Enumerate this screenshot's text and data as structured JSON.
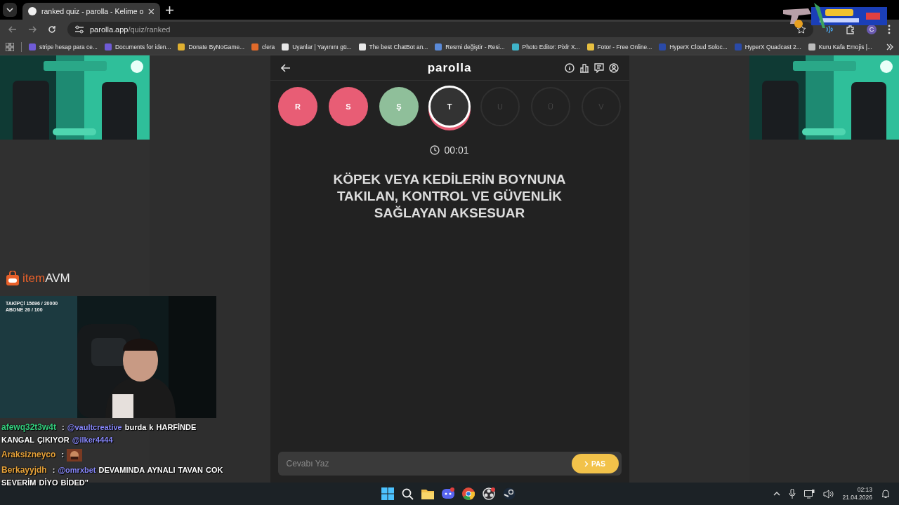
{
  "browser": {
    "tab_title": "ranked quiz - parolla - Kelime o",
    "url_host": "parolla.app",
    "url_path": "/quiz/ranked",
    "profile_initial": "C",
    "bookmarks": [
      {
        "label": "stripe hesap para ce...",
        "color": "#6f5bd6"
      },
      {
        "label": "Documents for iden...",
        "color": "#6f5bd6"
      },
      {
        "label": "Donate ByNoGame...",
        "color": "#e0b030"
      },
      {
        "label": "clera",
        "color": "#e06a2a"
      },
      {
        "label": "Uyanlar | Yayınını gü...",
        "color": "#e8e8e8"
      },
      {
        "label": "The best ChatBot an...",
        "color": "#e8e8e8"
      },
      {
        "label": "Resmi değiştir - Resi...",
        "color": "#5a8ad8"
      },
      {
        "label": "Photo Editor: Pixlr X...",
        "color": "#3fb3c8"
      },
      {
        "label": "Fotor - Free Online...",
        "color": "#e8c040"
      },
      {
        "label": "HyperX Cloud Soloc...",
        "color": "#2a4aa8"
      },
      {
        "label": "HyperX Quadcast 2...",
        "color": "#2a4aa8"
      },
      {
        "label": "Kuru Kafa Emojis |...",
        "color": "#bbbbbb"
      }
    ]
  },
  "app": {
    "title": "parolla",
    "letters": [
      {
        "letter": "R",
        "kind": "wrong"
      },
      {
        "letter": "S",
        "kind": "wrong"
      },
      {
        "letter": "Ş",
        "kind": "correct"
      },
      {
        "letter": "T",
        "kind": "current"
      },
      {
        "letter": "U",
        "kind": "pending"
      },
      {
        "letter": "Ü",
        "kind": "pending"
      },
      {
        "letter": "V",
        "kind": "pending"
      }
    ],
    "timer": "00:01",
    "question": "KÖPEK VEYA KEDİLERİN BOYNUNA TAKILAN, KONTROL VE GÜVENLİK SAĞLAYAN AKSESUAR",
    "answer": {
      "placeholder": "Cevabı Yaz"
    },
    "pass_button": "PAS"
  },
  "stream_overlay": {
    "logo": {
      "first": "item",
      "second": "AVM"
    },
    "stats": [
      "TAKİPÇİ 15696 / 20000",
      "ABONE 26 / 100"
    ],
    "chat": [
      {
        "user": "afewq32t3w4t",
        "separator": ":",
        "color": "#35d07f",
        "kind": "text",
        "parts": [
          {
            "text": "@vaultcreative",
            "mention": true
          },
          {
            "text": "burda k HARFİNDE",
            "mention": false
          },
          {
            "text": "KANGAL ÇIKIYOR",
            "mention": false
          },
          {
            "text": "@ilker4444",
            "mention": true
          }
        ]
      },
      {
        "user": "Araksizneyco",
        "separator": ":",
        "color": "#e8a33a",
        "kind": "emote"
      },
      {
        "user": "Berkayyjdh",
        "separator": ":",
        "color": "#e8a33a",
        "kind": "text",
        "parts": [
          {
            "text": "@omrxbet",
            "mention": true
          },
          {
            "text": "DEVAMINDA AYNALI TAVAN COK",
            "mention": false
          },
          {
            "text": "SEVERİM DİYO BİDED\"",
            "mention": false
          }
        ]
      }
    ]
  },
  "taskbar": {
    "time": "02:13",
    "date": "21.04.2026"
  }
}
